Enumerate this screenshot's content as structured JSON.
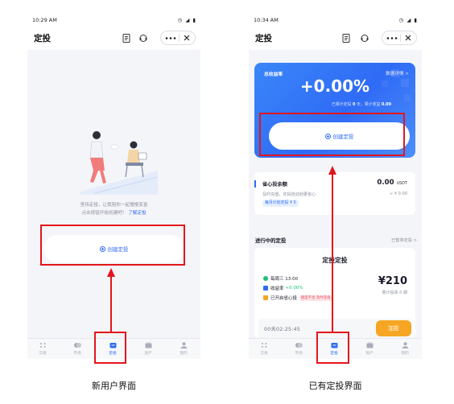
{
  "left": {
    "status": {
      "time": "10:29 AM",
      "icons": "◷ ◢ ▮"
    },
    "header": {
      "title": "定投"
    },
    "intro": {
      "line1": "坚持定投，让我陪你一起慢慢变富",
      "line2": "点击按钮开始创建吧！",
      "link": "了解定投"
    },
    "create_button": {
      "label": "创建定投"
    },
    "tabs": [
      {
        "label": "交易",
        "icon": "trade-icon"
      },
      {
        "label": "市场",
        "icon": "market-icon"
      },
      {
        "label": "定投",
        "icon": "invest-icon"
      },
      {
        "label": "资产",
        "icon": "assets-icon"
      },
      {
        "label": "我的",
        "icon": "user-icon"
      }
    ],
    "active_tab": 2
  },
  "right": {
    "status": {
      "time": "10:34 AM",
      "icons": "◷ ◢ ▮"
    },
    "header": {
      "title": "定投"
    },
    "earnings": {
      "label": "总收益率",
      "detail_link": "数据详情 >",
      "rate": "+0.00%",
      "sub_prefix": "已累计定投",
      "days": "0",
      "sub_middle": "天，累计收益",
      "profit": "0.00"
    },
    "create_button": {
      "label": "创建定投"
    },
    "balance": {
      "title": "省心投余额",
      "amount": "0.00",
      "unit": "USDT",
      "desc": "及时充值，定投自动划更省心",
      "fiat": "≈ ¥ 0.00",
      "tag": "每月计划定投 ¥ 0"
    },
    "section": {
      "title": "进行中的定投",
      "link": "已暂停定投 >"
    },
    "plan": {
      "title": "定投定投",
      "schedule": "每周三 13:00",
      "rate_label": "收益率",
      "rate": "+0.00%",
      "mode": "已开启省心投",
      "badge": "额度不足 及时充值",
      "amount": "¥210",
      "invest_label": "累计投资 0 期",
      "countdown": "00天02:25:45",
      "add_label": "加投"
    },
    "tabs": [
      {
        "label": "交易",
        "icon": "trade-icon"
      },
      {
        "label": "市场",
        "icon": "market-icon"
      },
      {
        "label": "定投",
        "icon": "invest-icon"
      },
      {
        "label": "资产",
        "icon": "assets-icon"
      },
      {
        "label": "我的",
        "icon": "user-icon"
      }
    ],
    "active_tab": 2
  },
  "captions": {
    "left": "新用户界面",
    "right": "已有定投界面"
  },
  "colors": {
    "accent": "#2f6bf6",
    "highlight": "#e3151c",
    "add_button": "#f6a623",
    "gain": "#1ec279"
  }
}
